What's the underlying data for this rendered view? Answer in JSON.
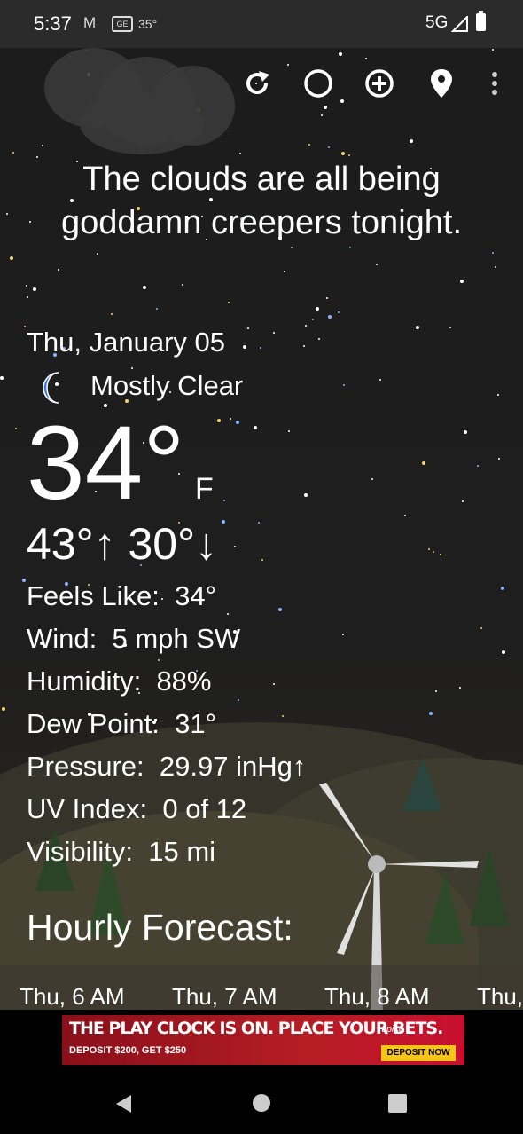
{
  "status_bar": {
    "time": "5:37",
    "mail_icon": "M",
    "ge_icon": "GE",
    "temperature": "35°",
    "network": "5G"
  },
  "toolbar": {
    "icons": [
      "refresh-icon",
      "moon-phase-icon",
      "add-location-icon",
      "location-pin-icon",
      "more-vert-icon"
    ]
  },
  "quote": "The clouds are all being goddamn creepers tonight.",
  "current": {
    "date": "Thu, January 05",
    "condition": "Mostly Clear",
    "temperature": "34°",
    "unit": "F",
    "high_low": "43°↑ 30°↓"
  },
  "details": [
    {
      "label": "Feels Like:",
      "value": "34°"
    },
    {
      "label": "Wind:",
      "value": "5 mph SW"
    },
    {
      "label": "Humidity:",
      "value": "88%"
    },
    {
      "label": "Dew Point:",
      "value": "31°"
    },
    {
      "label": "Pressure:",
      "value": "29.97 inHg↑"
    },
    {
      "label": "UV Index:",
      "value": "0 of 12"
    },
    {
      "label": "Visibility:",
      "value": "15 mi"
    }
  ],
  "hourly": {
    "title": "Hourly Forecast:",
    "hours": [
      "Thu, 6 AM",
      "Thu, 7 AM",
      "Thu, 8 AM",
      "Thu,"
    ]
  },
  "ad": {
    "headline": "THE PLAY CLOCK IS ON. PLACE YOUR BETS.",
    "sub": "DEPOSIT $200, GET $250",
    "brand": "tipico",
    "cta": "DEPOSIT NOW"
  },
  "colors": {
    "moon": "#3b7be0",
    "star_white": "#ffffff",
    "star_yellow": "#f2d36b",
    "star_blue": "#8ab4ff",
    "hill": "#3b3a2c",
    "tree": "#2f4a28"
  }
}
